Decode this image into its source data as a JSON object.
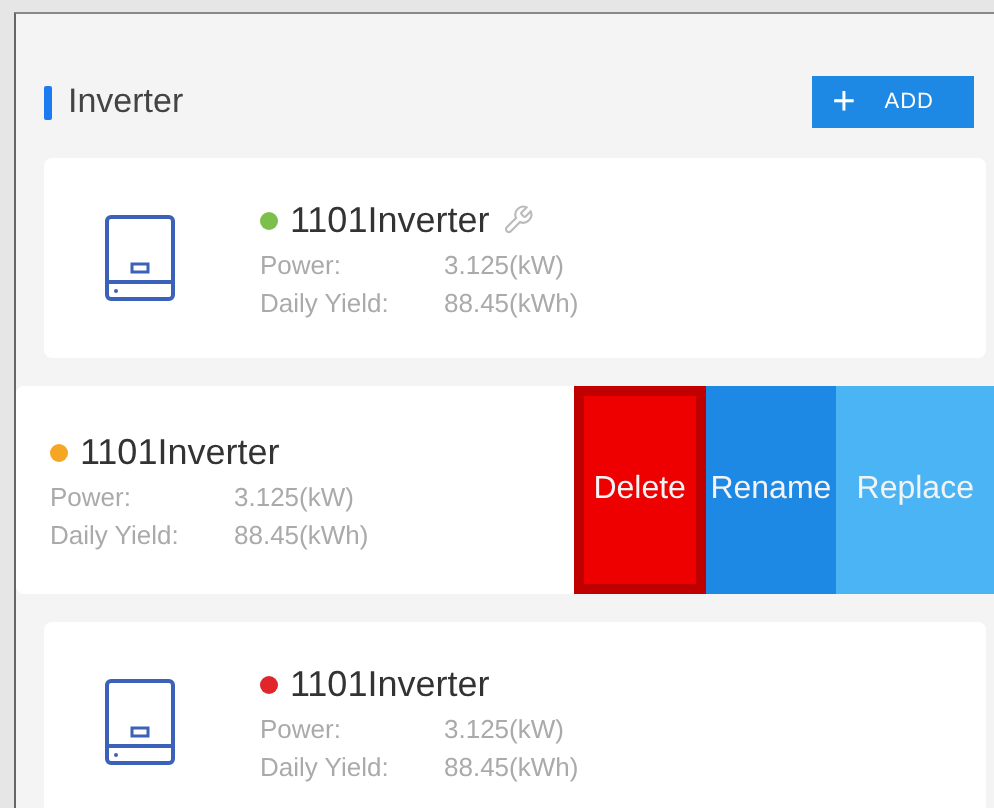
{
  "section": {
    "title": "Inverter",
    "add_button": {
      "icon": "+",
      "label": "ADD"
    }
  },
  "devices": [
    {
      "name": "1101Inverter",
      "color": "#7cc04b",
      "maintenance_mark": true,
      "swiped": false,
      "power_label": "Power:",
      "power": "3.125(kW)",
      "yield_label": "Daily Yield:",
      "yield": "88.45(kWh)"
    },
    {
      "name": "1101Inverter",
      "color": "#f5a623",
      "maintenance_mark": false,
      "swiped": true,
      "power_label": "Power:",
      "power": "3.125(kW)",
      "yield_label": "Daily Yield:",
      "yield": "88.45(kWh)",
      "actions": [
        {
          "kind": "delete",
          "label": "Delete",
          "highlighted": true
        },
        {
          "kind": "rename",
          "label": "Rename",
          "highlighted": false
        },
        {
          "kind": "replace",
          "label": "Replace",
          "highlighted": false
        }
      ]
    },
    {
      "name": "1101Inverter",
      "color": "#e0262b",
      "maintenance_mark": false,
      "swiped": false,
      "power_label": "Power:",
      "power": "3.125(kW)",
      "yield_label": "Daily Yield:",
      "yield": "88.45(kWh)"
    }
  ]
}
